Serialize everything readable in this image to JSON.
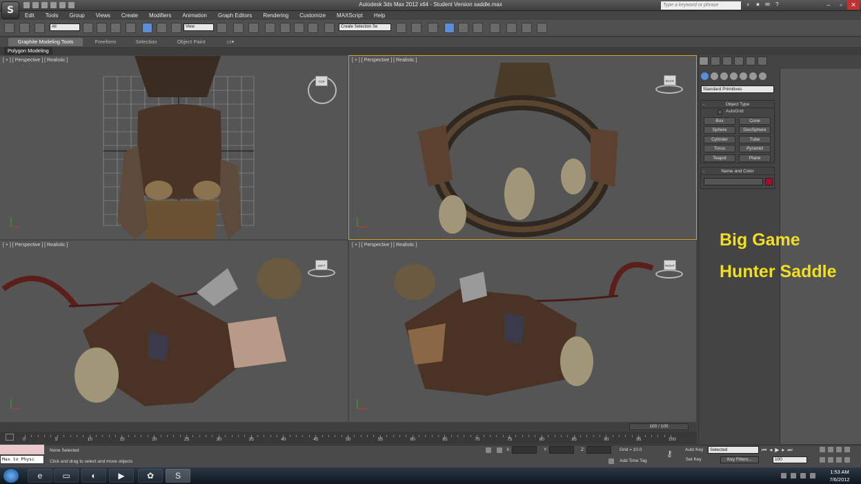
{
  "window": {
    "title": "Autodesk 3ds Max  2012 x64  - Student Version   saddle.max",
    "search_placeholder": "Type a keyword or phrase",
    "logo_text": "S"
  },
  "menu": [
    "Edit",
    "Tools",
    "Group",
    "Views",
    "Create",
    "Modifiers",
    "Animation",
    "Graph Editors",
    "Rendering",
    "Customize",
    "MAXScript",
    "Help"
  ],
  "toolbar": {
    "selection_filter": "All",
    "reference_coord": "View",
    "named_selection": "Create Selection Se"
  },
  "ribbon": {
    "tabs": [
      "Graphite Modeling Tools",
      "Freeform",
      "Selection",
      "Object Paint"
    ],
    "active_tab": "Graphite Modeling Tools",
    "sub_tab": "Polygon Modeling"
  },
  "viewports": [
    {
      "label": "[ + ] [ Perspective ] [ Realistic ]",
      "cube": "TOP"
    },
    {
      "label": "[ + ] [ Perspective ] [ Realistic ]",
      "cube": "BACK"
    },
    {
      "label": "[ + ] [ Perspective ] [ Realistic ]",
      "cube": "LEFT"
    },
    {
      "label": "[ + ] [ Perspective ] [ Realistic ]",
      "cube": "RIGHT"
    }
  ],
  "command_panel": {
    "category": "Standard Primitives",
    "object_type_header": "Object Type",
    "autogrid": "AutoGrid",
    "buttons": [
      "Box",
      "Cone",
      "Sphere",
      "GeoSphere",
      "Cylinder",
      "Tube",
      "Torus",
      "Pyramid",
      "Teapot",
      "Plane"
    ],
    "name_color_header": "Name and Color",
    "object_color": "#a0102a"
  },
  "overlay": {
    "line1": "Big Game",
    "line2": "Hunter Saddle",
    "color": "#f2df20"
  },
  "timeline": {
    "frame_counter": "100 / 100",
    "ticks": [
      "0",
      "5",
      "10",
      "15",
      "20",
      "25",
      "30",
      "35",
      "40",
      "45",
      "50",
      "55",
      "60",
      "65",
      "70",
      "75",
      "80",
      "85",
      "90",
      "95",
      "100"
    ]
  },
  "status": {
    "listener": "Max to Physc",
    "selection": "None Selected",
    "prompt": "Click and drag to select and move objects",
    "x_label": "X:",
    "y_label": "Y:",
    "z_label": "Z:",
    "grid": "Grid = 10.0",
    "auto_key": "Auto Key",
    "set_key": "Set Key",
    "key_mode": "Selected",
    "key_filters": "Key Filters...",
    "add_time_tag": "Add Time Tag",
    "current_frame": "100"
  },
  "taskbar": {
    "time": "1:53 AM",
    "date": "7/6/2012"
  }
}
